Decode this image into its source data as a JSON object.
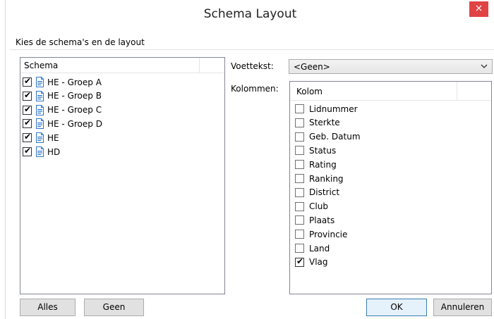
{
  "window": {
    "title": "Schema Layout",
    "close_label": "×"
  },
  "subtitle": "Kies de schema's en de layout",
  "schema_list": {
    "header": "Schema",
    "items": [
      {
        "label": "HE - Groep A",
        "checked": true
      },
      {
        "label": "HE - Groep B",
        "checked": true
      },
      {
        "label": "HE - Groep C",
        "checked": true
      },
      {
        "label": "HE - Groep D",
        "checked": true
      },
      {
        "label": "HE",
        "checked": true
      },
      {
        "label": "HD",
        "checked": true
      }
    ]
  },
  "voettekst": {
    "label": "Voettekst:",
    "value": "<Geen>"
  },
  "kolommen": {
    "label": "Kolommen:",
    "header": "Kolom",
    "items": [
      {
        "label": "Lidnummer",
        "checked": false
      },
      {
        "label": "Sterkte",
        "checked": false
      },
      {
        "label": "Geb. Datum",
        "checked": false
      },
      {
        "label": "Status",
        "checked": false
      },
      {
        "label": "Rating",
        "checked": false
      },
      {
        "label": "Ranking",
        "checked": false
      },
      {
        "label": "District",
        "checked": false
      },
      {
        "label": "Club",
        "checked": false
      },
      {
        "label": "Plaats",
        "checked": false
      },
      {
        "label": "Provincie",
        "checked": false
      },
      {
        "label": "Land",
        "checked": false
      },
      {
        "label": "Vlag",
        "checked": true
      }
    ]
  },
  "buttons": {
    "alles": "Alles",
    "geen": "Geen",
    "ok": "OK",
    "annuleren": "Annuleren"
  },
  "colors": {
    "close_bg": "#e04343",
    "default_button_border": "#3c7fb1",
    "icon_blue": "#2f76c9"
  },
  "icons": {
    "checkbox_mark": "✔",
    "dropdown": "chevron-down-icon",
    "schema_item": "document-icon"
  }
}
